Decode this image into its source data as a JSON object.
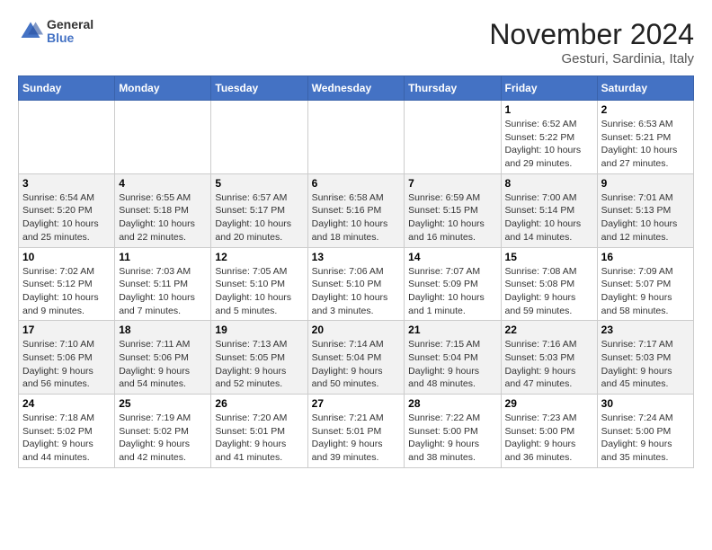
{
  "header": {
    "logo_general": "General",
    "logo_blue": "Blue",
    "month_title": "November 2024",
    "location": "Gesturi, Sardinia, Italy"
  },
  "weekdays": [
    "Sunday",
    "Monday",
    "Tuesday",
    "Wednesday",
    "Thursday",
    "Friday",
    "Saturday"
  ],
  "weeks": [
    [
      {
        "day": "",
        "info": ""
      },
      {
        "day": "",
        "info": ""
      },
      {
        "day": "",
        "info": ""
      },
      {
        "day": "",
        "info": ""
      },
      {
        "day": "",
        "info": ""
      },
      {
        "day": "1",
        "info": "Sunrise: 6:52 AM\nSunset: 5:22 PM\nDaylight: 10 hours and 29 minutes."
      },
      {
        "day": "2",
        "info": "Sunrise: 6:53 AM\nSunset: 5:21 PM\nDaylight: 10 hours and 27 minutes."
      }
    ],
    [
      {
        "day": "3",
        "info": "Sunrise: 6:54 AM\nSunset: 5:20 PM\nDaylight: 10 hours and 25 minutes."
      },
      {
        "day": "4",
        "info": "Sunrise: 6:55 AM\nSunset: 5:18 PM\nDaylight: 10 hours and 22 minutes."
      },
      {
        "day": "5",
        "info": "Sunrise: 6:57 AM\nSunset: 5:17 PM\nDaylight: 10 hours and 20 minutes."
      },
      {
        "day": "6",
        "info": "Sunrise: 6:58 AM\nSunset: 5:16 PM\nDaylight: 10 hours and 18 minutes."
      },
      {
        "day": "7",
        "info": "Sunrise: 6:59 AM\nSunset: 5:15 PM\nDaylight: 10 hours and 16 minutes."
      },
      {
        "day": "8",
        "info": "Sunrise: 7:00 AM\nSunset: 5:14 PM\nDaylight: 10 hours and 14 minutes."
      },
      {
        "day": "9",
        "info": "Sunrise: 7:01 AM\nSunset: 5:13 PM\nDaylight: 10 hours and 12 minutes."
      }
    ],
    [
      {
        "day": "10",
        "info": "Sunrise: 7:02 AM\nSunset: 5:12 PM\nDaylight: 10 hours and 9 minutes."
      },
      {
        "day": "11",
        "info": "Sunrise: 7:03 AM\nSunset: 5:11 PM\nDaylight: 10 hours and 7 minutes."
      },
      {
        "day": "12",
        "info": "Sunrise: 7:05 AM\nSunset: 5:10 PM\nDaylight: 10 hours and 5 minutes."
      },
      {
        "day": "13",
        "info": "Sunrise: 7:06 AM\nSunset: 5:10 PM\nDaylight: 10 hours and 3 minutes."
      },
      {
        "day": "14",
        "info": "Sunrise: 7:07 AM\nSunset: 5:09 PM\nDaylight: 10 hours and 1 minute."
      },
      {
        "day": "15",
        "info": "Sunrise: 7:08 AM\nSunset: 5:08 PM\nDaylight: 9 hours and 59 minutes."
      },
      {
        "day": "16",
        "info": "Sunrise: 7:09 AM\nSunset: 5:07 PM\nDaylight: 9 hours and 58 minutes."
      }
    ],
    [
      {
        "day": "17",
        "info": "Sunrise: 7:10 AM\nSunset: 5:06 PM\nDaylight: 9 hours and 56 minutes."
      },
      {
        "day": "18",
        "info": "Sunrise: 7:11 AM\nSunset: 5:06 PM\nDaylight: 9 hours and 54 minutes."
      },
      {
        "day": "19",
        "info": "Sunrise: 7:13 AM\nSunset: 5:05 PM\nDaylight: 9 hours and 52 minutes."
      },
      {
        "day": "20",
        "info": "Sunrise: 7:14 AM\nSunset: 5:04 PM\nDaylight: 9 hours and 50 minutes."
      },
      {
        "day": "21",
        "info": "Sunrise: 7:15 AM\nSunset: 5:04 PM\nDaylight: 9 hours and 48 minutes."
      },
      {
        "day": "22",
        "info": "Sunrise: 7:16 AM\nSunset: 5:03 PM\nDaylight: 9 hours and 47 minutes."
      },
      {
        "day": "23",
        "info": "Sunrise: 7:17 AM\nSunset: 5:03 PM\nDaylight: 9 hours and 45 minutes."
      }
    ],
    [
      {
        "day": "24",
        "info": "Sunrise: 7:18 AM\nSunset: 5:02 PM\nDaylight: 9 hours and 44 minutes."
      },
      {
        "day": "25",
        "info": "Sunrise: 7:19 AM\nSunset: 5:02 PM\nDaylight: 9 hours and 42 minutes."
      },
      {
        "day": "26",
        "info": "Sunrise: 7:20 AM\nSunset: 5:01 PM\nDaylight: 9 hours and 41 minutes."
      },
      {
        "day": "27",
        "info": "Sunrise: 7:21 AM\nSunset: 5:01 PM\nDaylight: 9 hours and 39 minutes."
      },
      {
        "day": "28",
        "info": "Sunrise: 7:22 AM\nSunset: 5:00 PM\nDaylight: 9 hours and 38 minutes."
      },
      {
        "day": "29",
        "info": "Sunrise: 7:23 AM\nSunset: 5:00 PM\nDaylight: 9 hours and 36 minutes."
      },
      {
        "day": "30",
        "info": "Sunrise: 7:24 AM\nSunset: 5:00 PM\nDaylight: 9 hours and 35 minutes."
      }
    ]
  ]
}
